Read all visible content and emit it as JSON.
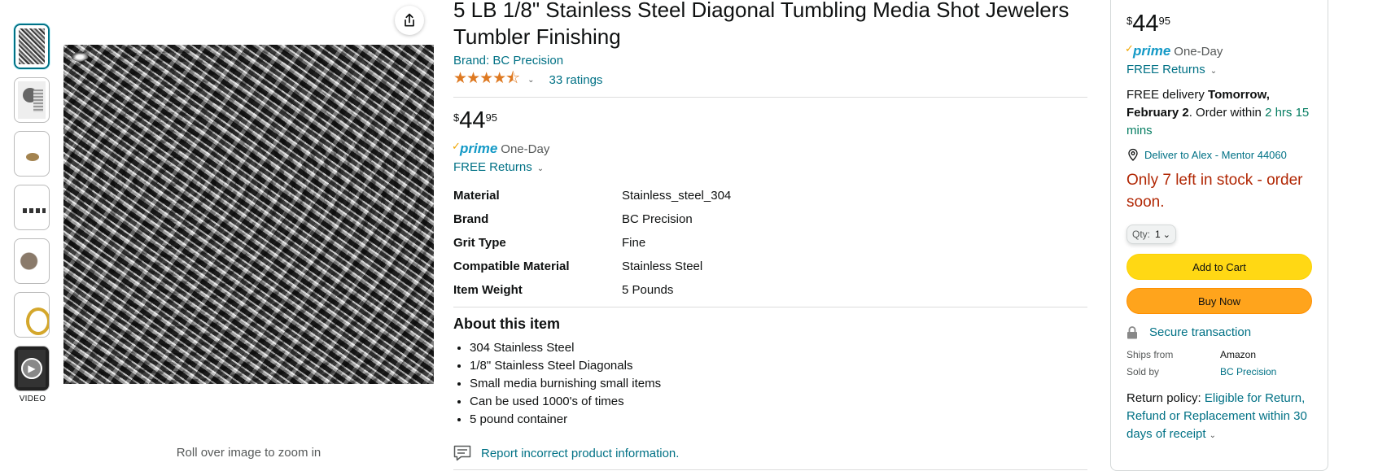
{
  "gallery": {
    "video_label": "VIDEO",
    "zoom_hint": "Roll over image to zoom in"
  },
  "product": {
    "title": "5 LB 1/8\" Stainless Steel Diagonal Tumbling Media Shot Jewelers Tumbler Finishing",
    "brand_link": "Brand: BC Precision",
    "rating_stars": "★★★★⯪",
    "rating_value": 4.5,
    "ratings_count": "33 ratings",
    "price": {
      "symbol": "$",
      "whole": "44",
      "fraction": "95"
    },
    "prime_label": "prime",
    "prime_speed": "One-Day",
    "returns": "FREE Returns",
    "specs": [
      {
        "key": "Material",
        "value": "Stainless_steel_304"
      },
      {
        "key": "Brand",
        "value": "BC Precision"
      },
      {
        "key": "Grit Type",
        "value": "Fine"
      },
      {
        "key": "Compatible Material",
        "value": "Stainless Steel"
      },
      {
        "key": "Item Weight",
        "value": "5 Pounds"
      }
    ],
    "about_heading": "About this item",
    "bullets": [
      "304 Stainless Steel",
      "1/8\" Stainless Steel Diagonals",
      "Small media burnishing small items",
      "Can be used 1000's of times",
      "5 pound container"
    ],
    "report_link": "Report incorrect product information."
  },
  "buybox": {
    "price": {
      "symbol": "$",
      "whole": "44",
      "fraction": "95"
    },
    "prime_label": "prime",
    "prime_speed": "One-Day",
    "returns": "FREE Returns",
    "delivery_prefix": "FREE delivery ",
    "delivery_date": "Tomorrow, February 2",
    "delivery_mid": ". Order within ",
    "delivery_countdown": "2 hrs 15 mins",
    "deliver_to": "Deliver to Alex - Mentor 44060",
    "stock": "Only 7 left in stock - order soon.",
    "qty_label": "Qty:",
    "qty_value": "1",
    "add_to_cart": "Add to Cart",
    "buy_now": "Buy Now",
    "secure": "Secure transaction",
    "ships_from_label": "Ships from",
    "ships_from": "Amazon",
    "sold_by_label": "Sold by",
    "sold_by": "BC Precision",
    "return_policy_label": "Return policy: ",
    "return_policy": "Eligible for Return, Refund or Replacement within 30 days of receipt"
  },
  "colors": {
    "link": "#007185",
    "cart_button": "#FFD814",
    "buy_button": "#FFA41C",
    "stock_warning": "#B12704",
    "star": "#DE7921"
  }
}
